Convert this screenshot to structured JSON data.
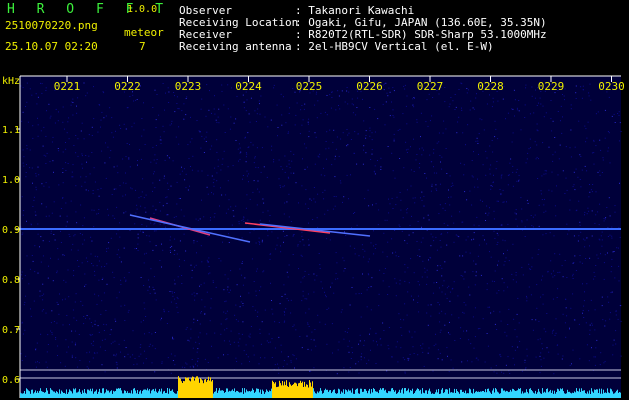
{
  "app": {
    "name": "H R O F F T",
    "version": "1.0.0"
  },
  "file": {
    "name": "2510070220.png",
    "datetime": "25.10.07 02:20"
  },
  "detection": {
    "label": "meteor",
    "count": "7"
  },
  "station": [
    {
      "key": "Observer",
      "value": ": Takanori Kawachi"
    },
    {
      "key": "Receiving Location",
      "value": ": Ogaki, Gifu, JAPAN (136.60E, 35.35N)"
    },
    {
      "key": "Receiver",
      "value": ": R820T2(RTL-SDR) SDR-Sharp 53.1000MHz"
    },
    {
      "key": "Receiving antenna",
      "value": ": 2el-HB9CV Vertical (el. E-W)"
    }
  ],
  "spectrogram": {
    "yunit": "kHz",
    "time_ticks": [
      "0221",
      "0222",
      "0223",
      "0224",
      "0225",
      "0226",
      "0227",
      "0228",
      "0229",
      "0230"
    ],
    "freq_ticks": [
      "1.1",
      "1.0",
      "0.9",
      "0.8",
      "0.7",
      "0.6"
    ],
    "colors": {
      "bg": "#00003a",
      "noise": "#0c0c8a",
      "carrier": "#3b6cff",
      "axis": "#ffffff",
      "tick_text": "#f0f000",
      "bar": "#33d6ff",
      "bar_hot": "#ffd400"
    }
  }
}
